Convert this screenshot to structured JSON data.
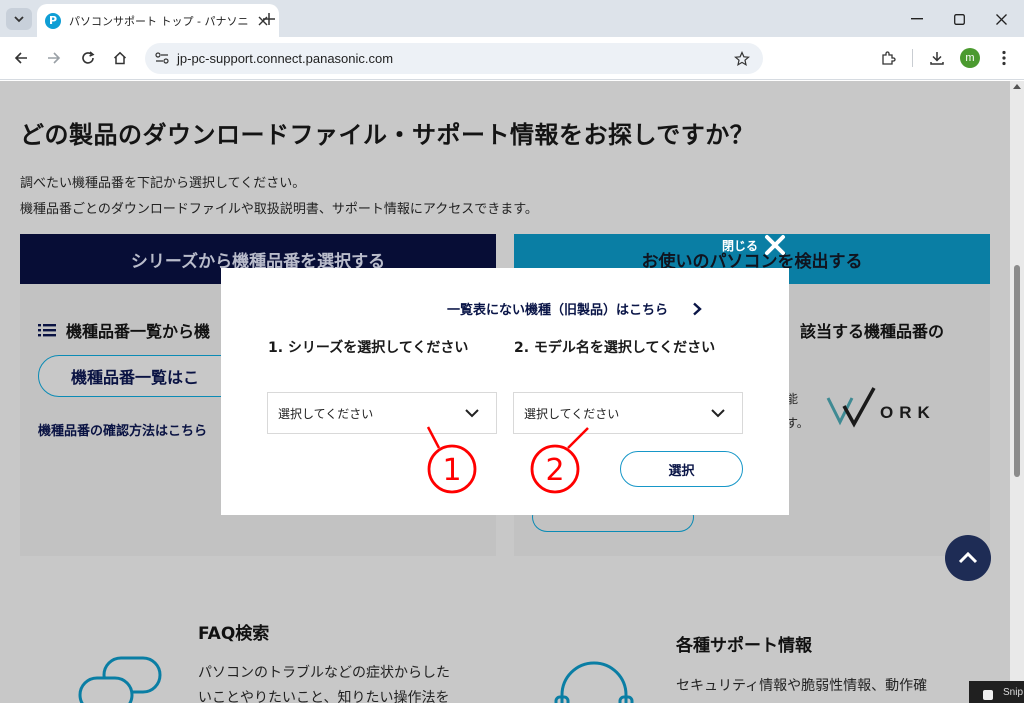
{
  "browser": {
    "tab_title": "パソコンサポート トップ - パナソニック",
    "favicon_letter": "P",
    "url": "jp-pc-support.connect.panasonic.com",
    "profile_initial": "m",
    "icons": [
      "tab-search-icon",
      "close-icon",
      "plus-icon",
      "minimize-icon",
      "maximize-icon",
      "close-window-icon",
      "back-icon",
      "forward-icon",
      "reload-icon",
      "home-icon",
      "site-info-icon",
      "star-icon",
      "extensions-icon",
      "download-icon",
      "menu-icon"
    ]
  },
  "page": {
    "heading": "どの製品のダウンロードファイル・サポート情報をお探しですか？",
    "intro_1": "調べたい機種品番を下記から選択してください。",
    "intro_2": "機種品番ごとのダウンロードファイルや取扱説明書、サポート情報にアクセスできます。",
    "left_panel": {
      "header": "シリーズから機種品番を選択する",
      "list_title": "機種品番一覧から機",
      "list_button": "機種品番一覧はこ",
      "check_link": "機種品番の確認方法はこちら"
    },
    "right_panel": {
      "header": "お使いのパソコンを検出する",
      "title": "該当する機種品番の",
      "fragment_1": "能",
      "fragment_2": "す。",
      "logo_text": "VVORK"
    },
    "faq": {
      "title": "FAQ検索",
      "line_1": "パソコンのトラブルなどの症状からした",
      "line_2": "いことやりたいこと、知りたい操作法を"
    },
    "support": {
      "title": "各種サポート情報",
      "line_1": "セキュリティ情報や脆弱性情報、動作確"
    },
    "snip_label": "Snip"
  },
  "modal": {
    "close_label": "閉じる",
    "old_models_link": "一覧表にない機種（旧製品）はこちら",
    "step1_label": "1. シリーズを選択してください",
    "step2_label": "2. モデル名を選択してください",
    "select1_value": "選択してください",
    "select2_value": "選択してください",
    "submit_label": "選択"
  },
  "annotations": {
    "mark_1": "①",
    "mark_2": "②",
    "color": "#ff0000"
  },
  "colors": {
    "navy": "#070d36",
    "teal": "#0a7ea4",
    "accent_border": "#1797c8",
    "overlay_bg": "#c8c8c8"
  }
}
